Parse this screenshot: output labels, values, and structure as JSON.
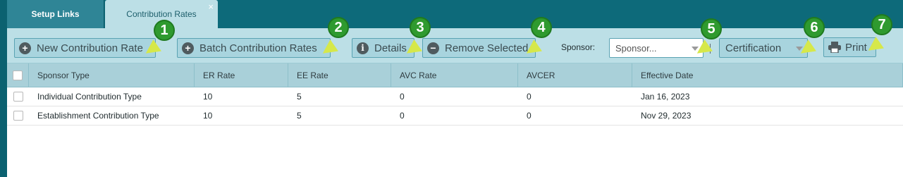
{
  "tabs": [
    {
      "label": "Setup Links"
    },
    {
      "label": "Contribution Rates",
      "close": "×"
    }
  ],
  "toolbar": {
    "new_label": "New Contribution Rate",
    "batch_label": "Batch Contribution Rates",
    "details_label": "Details",
    "remove_label": "Remove Selected",
    "sponsor_label": "Sponsor:",
    "sponsor_placeholder": "Sponsor...",
    "certification_label": "Certification",
    "print_label": "Print"
  },
  "markers": [
    "1",
    "2",
    "3",
    "4",
    "5",
    "6",
    "7"
  ],
  "table": {
    "columns": [
      "Sponsor Type",
      "ER Rate",
      "EE Rate",
      "AVC Rate",
      "AVCER",
      "Effective Date"
    ],
    "rows": [
      [
        "Individual Contribution Type",
        "10",
        "5",
        "0",
        "0",
        "Jan 16, 2023"
      ],
      [
        "Establishment Contribution Type",
        "10",
        "5",
        "0",
        "0",
        "Nov 29, 2023"
      ]
    ]
  },
  "colors": {
    "header_bar": "#0d6a7a",
    "toolbar_bg": "#bcdfe6",
    "grid_header_bg": "#a9d0d9",
    "marker_green": "#2f9a2f",
    "pointer_yellow": "#d6e84a"
  },
  "icons": [
    "plus-circle-icon",
    "info-circle-icon",
    "minus-circle-icon",
    "printer-icon",
    "close-icon",
    "chevron-down-icon"
  ]
}
